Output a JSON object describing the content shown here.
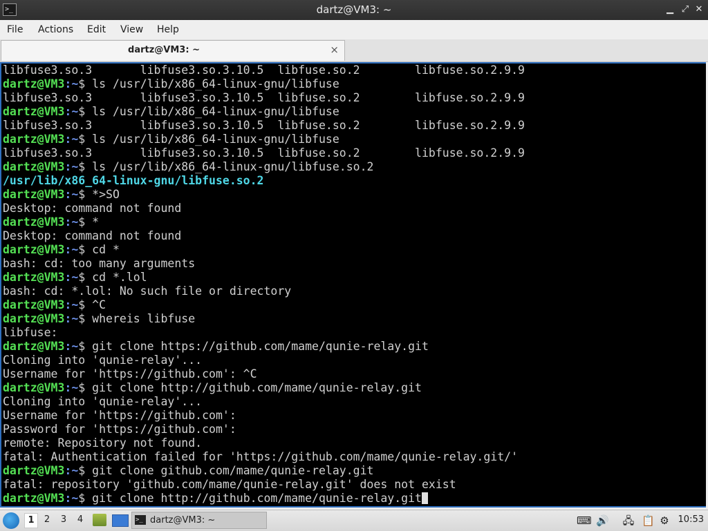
{
  "window": {
    "title": "dartz@VM3: ~",
    "minimize_icon": "minimize-icon",
    "restore_icon": "restore-icon",
    "close_icon": "close-icon"
  },
  "menu": {
    "file": "File",
    "actions": "Actions",
    "edit": "Edit",
    "view": "View",
    "help": "Help"
  },
  "tab": {
    "label": "dartz@VM3: ~",
    "close_glyph": "×"
  },
  "prompt": {
    "user": "dartz@VM3",
    "path": ":~",
    "sym": "$ "
  },
  "terminal_lines": [
    {
      "type": "out",
      "text": "libfuse3.so.3       libfuse3.so.3.10.5  libfuse.so.2        libfuse.so.2.9.9"
    },
    {
      "type": "cmd",
      "text": "ls /usr/lib/x86_64-linux-gnu/libfuse"
    },
    {
      "type": "out",
      "text": "libfuse3.so.3       libfuse3.so.3.10.5  libfuse.so.2        libfuse.so.2.9.9"
    },
    {
      "type": "cmd",
      "text": "ls /usr/lib/x86_64-linux-gnu/libfuse"
    },
    {
      "type": "out",
      "text": "libfuse3.so.3       libfuse3.so.3.10.5  libfuse.so.2        libfuse.so.2.9.9"
    },
    {
      "type": "cmd",
      "text": "ls /usr/lib/x86_64-linux-gnu/libfuse"
    },
    {
      "type": "out",
      "text": "libfuse3.so.3       libfuse3.so.3.10.5  libfuse.so.2        libfuse.so.2.9.9"
    },
    {
      "type": "cmd",
      "text": "ls /usr/lib/x86_64-linux-gnu/libfuse.so.2"
    },
    {
      "type": "out-bold",
      "text": "/usr/lib/x86_64-linux-gnu/libfuse.so.2"
    },
    {
      "type": "cmd",
      "text": "*>SO"
    },
    {
      "type": "out",
      "text": "Desktop: command not found"
    },
    {
      "type": "cmd",
      "text": "*"
    },
    {
      "type": "out",
      "text": "Desktop: command not found"
    },
    {
      "type": "cmd",
      "text": "cd *"
    },
    {
      "type": "out",
      "text": "bash: cd: too many arguments"
    },
    {
      "type": "cmd",
      "text": "cd *.lol"
    },
    {
      "type": "out",
      "text": "bash: cd: *.lol: No such file or directory"
    },
    {
      "type": "cmd",
      "text": "^C"
    },
    {
      "type": "cmd",
      "text": "whereis libfuse"
    },
    {
      "type": "out",
      "text": "libfuse:"
    },
    {
      "type": "cmd",
      "text": "git clone https://github.com/mame/qunie-relay.git"
    },
    {
      "type": "out",
      "text": "Cloning into 'qunie-relay'..."
    },
    {
      "type": "out",
      "text": "Username for 'https://github.com': ^C"
    },
    {
      "type": "cmd",
      "text": "git clone http://github.com/mame/qunie-relay.git"
    },
    {
      "type": "out",
      "text": "Cloning into 'qunie-relay'..."
    },
    {
      "type": "out",
      "text": "Username for 'https://github.com':"
    },
    {
      "type": "out",
      "text": "Password for 'https://github.com':"
    },
    {
      "type": "out",
      "text": "remote: Repository not found."
    },
    {
      "type": "out",
      "text": "fatal: Authentication failed for 'https://github.com/mame/qunie-relay.git/'"
    },
    {
      "type": "cmd",
      "text": "git clone github.com/mame/qunie-relay.git"
    },
    {
      "type": "out",
      "text": "fatal: repository 'github.com/mame/qunie-relay.git' does not exist"
    },
    {
      "type": "cmd-current",
      "text": "git clone http://github.com/mame/qunie-relay.git"
    }
  ],
  "taskbar": {
    "start_icon": "lubuntu-start-icon",
    "workspaces": [
      "1",
      "2",
      "3",
      "4"
    ],
    "active_workspace": "1",
    "task_label": "dartz@VM3: ~",
    "clock": "10:53",
    "tray": {
      "keyboard_glyph": "⌨",
      "volume_glyph": "🔊",
      "network_glyph": "🖧",
      "clipboard_glyph": "📋",
      "update_glyph": "⚙"
    }
  }
}
